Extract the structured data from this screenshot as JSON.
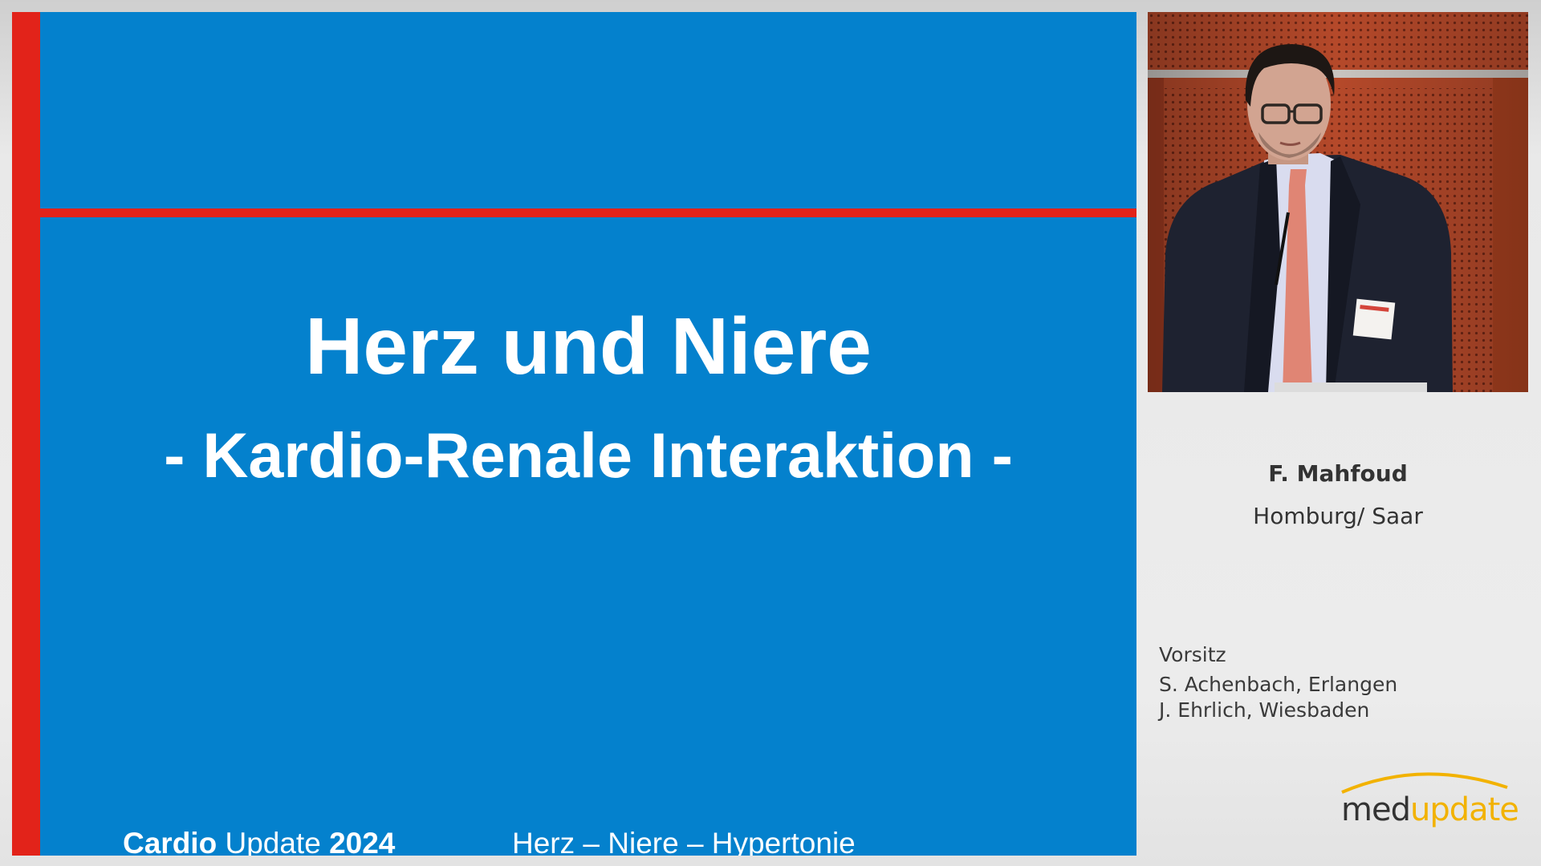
{
  "slide": {
    "title": "Herz und Niere",
    "subtitle": "- Kardio-Renale Interaktion -",
    "footer": {
      "brand_bold": "Cardio",
      "brand_regular": " Update ",
      "brand_year": "2024",
      "topic": "Herz – Niere – Hypertonie"
    },
    "colors": {
      "background": "#0481cd",
      "accent": "#e2231a",
      "text": "#ffffff"
    }
  },
  "speaker": {
    "name": "F. Mahfoud",
    "location": "Homburg/ Saar"
  },
  "chair": {
    "label": "Vorsitz",
    "members": [
      "S. Achenbach, Erlangen",
      "J. Ehrlich, Wiesbaden"
    ]
  },
  "logo": {
    "part1": "med",
    "part2": "update",
    "colors": {
      "part1": "#333333",
      "part2": "#f2b200"
    }
  }
}
